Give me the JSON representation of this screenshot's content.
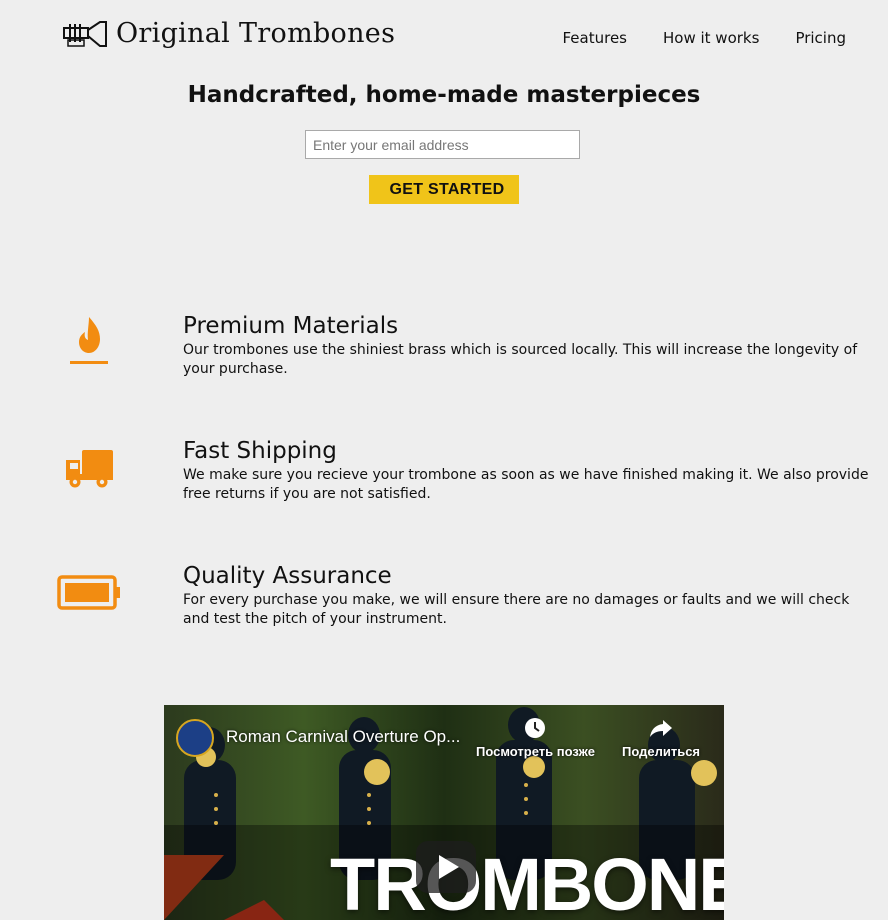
{
  "header": {
    "logo_text": "Original Trombones",
    "nav": [
      {
        "label": "Features"
      },
      {
        "label": "How it works"
      },
      {
        "label": "Pricing"
      }
    ]
  },
  "hero": {
    "title": "Handcrafted, home-made masterpieces",
    "email_placeholder": "Enter your email address",
    "cta_label": "GET STARTED"
  },
  "features": [
    {
      "icon": "fire-icon",
      "title": "Premium Materials",
      "description": "Our trombones use the shiniest brass which is sourced locally. This will increase the longevity of your purchase."
    },
    {
      "icon": "truck-icon",
      "title": "Fast Shipping",
      "description": "We make sure you recieve your trombone as soon as we have finished making it. We also provide free returns if you are not satisfied."
    },
    {
      "icon": "battery-full-icon",
      "title": "Quality Assurance",
      "description": "For every purchase you make, we will ensure there are no damages or faults and we will check and test the pitch of your instrument."
    }
  ],
  "video": {
    "title": "Roman Carnival Overture Op...",
    "watch_later_label": "Посмотреть позже",
    "share_label": "Поделиться",
    "overlay_text": "TROMBONE"
  },
  "colors": {
    "accent_orange": "#f28c11",
    "cta_yellow": "#f0c419",
    "background": "#eeeeee"
  }
}
